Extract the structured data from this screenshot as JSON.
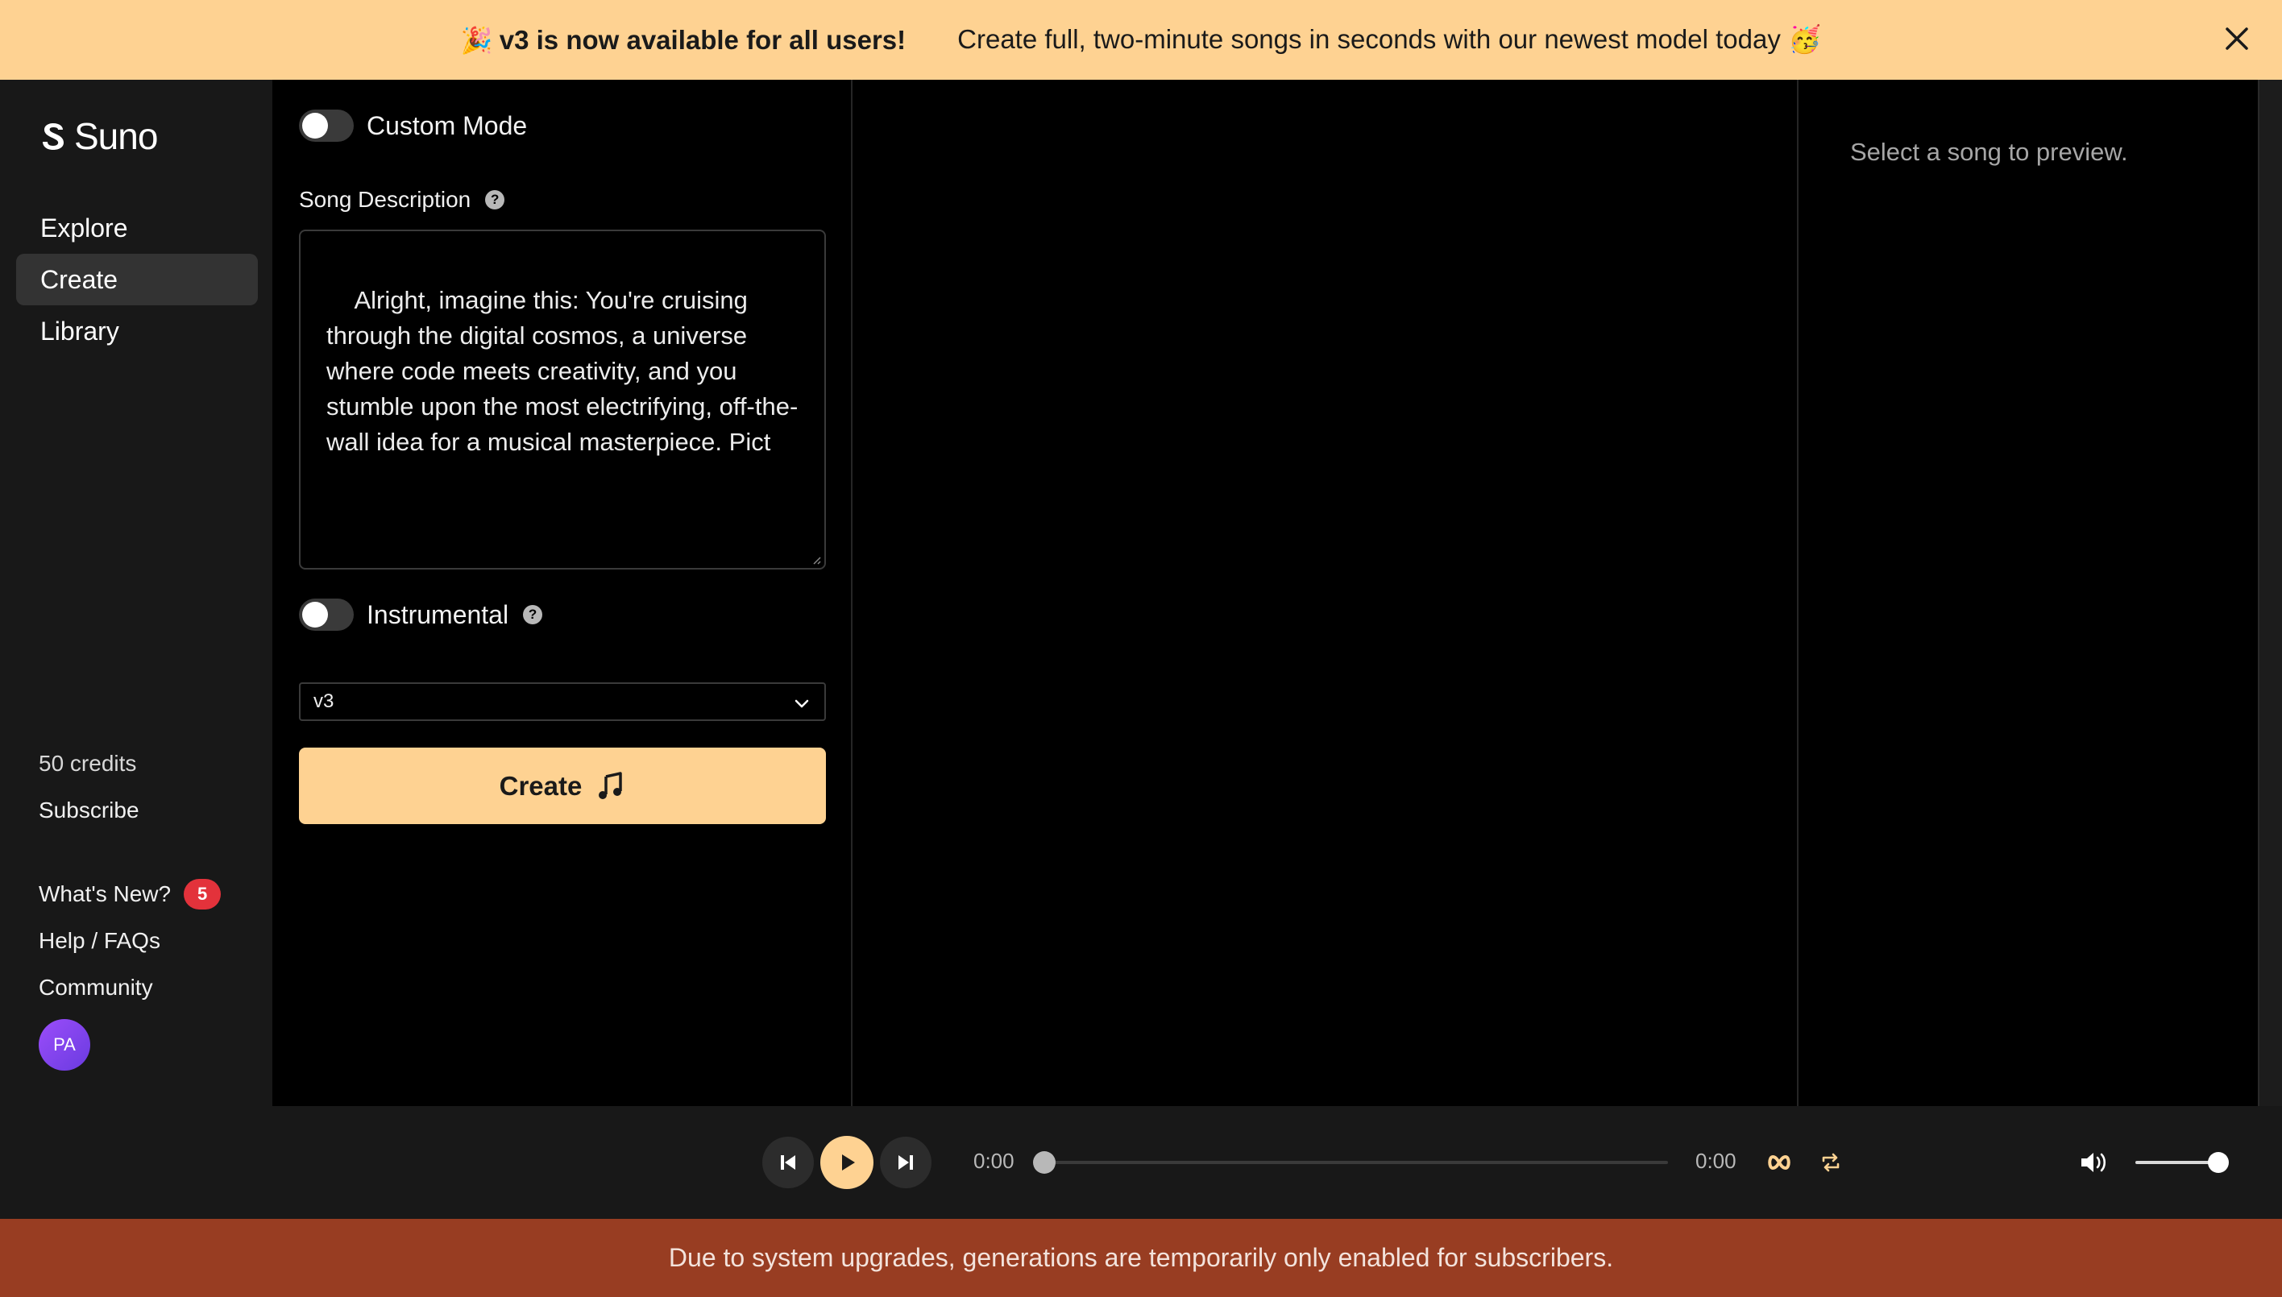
{
  "banner": {
    "emoji": "🎉",
    "headline": "v3 is now available for all users!",
    "message": "Create full, two-minute songs in seconds with our newest model today 🥳"
  },
  "sidebar": {
    "brand": "Suno",
    "nav": [
      {
        "label": "Explore",
        "active": false
      },
      {
        "label": "Create",
        "active": true
      },
      {
        "label": "Library",
        "active": false
      }
    ],
    "credits": "50 credits",
    "subscribe": "Subscribe",
    "whats_new": "What's New?",
    "whats_new_count": "5",
    "help": "Help / FAQs",
    "community": "Community",
    "avatar_initials": "PA"
  },
  "create": {
    "custom_mode_label": "Custom Mode",
    "custom_mode_on": false,
    "song_description_label": "Song Description",
    "song_description_value": "Alright, imagine this: You're cruising through the digital cosmos, a universe where code meets creativity, and you stumble upon the most electrifying, off-the-wall idea for a musical masterpiece. Pict",
    "instrumental_label": "Instrumental",
    "instrumental_on": false,
    "model_selected": "v3",
    "create_button": "Create"
  },
  "preview": {
    "hint": "Select a song to preview."
  },
  "player": {
    "current_time": "0:00",
    "duration": "0:00",
    "progress": 0,
    "volume": 1.0
  },
  "notice": {
    "text": "Due to system upgrades, generations are temporarily only enabled for subscribers."
  },
  "colors": {
    "accent": "#fed292",
    "banner_bg": "#fed292",
    "sidebar_bg": "#181818",
    "notice_bg": "#983d22",
    "badge": "#e3323b"
  }
}
